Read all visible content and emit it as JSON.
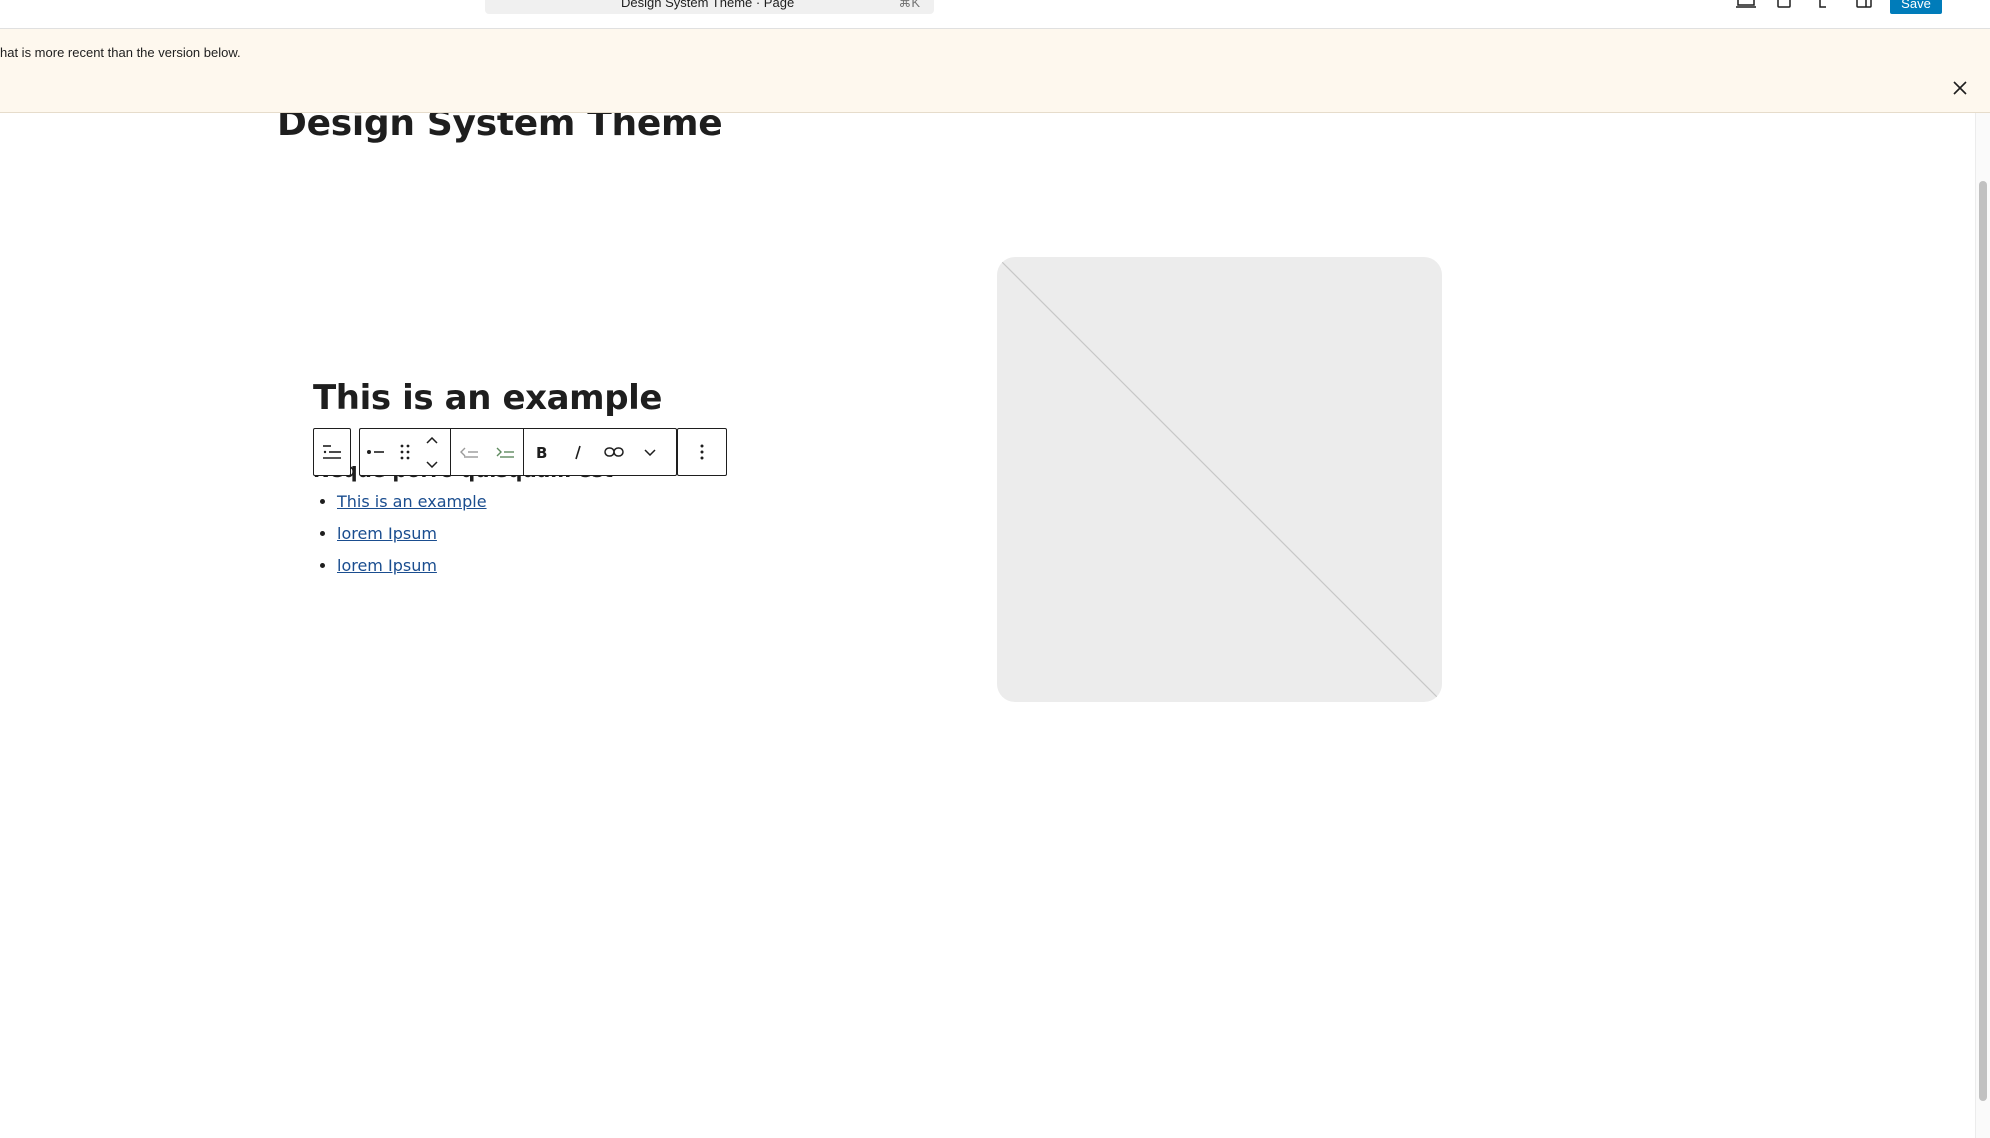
{
  "topbar": {
    "document_title": "Design System Theme · Page",
    "shortcut": "⌘K",
    "save_label": "Save",
    "icons": [
      "preview-icon",
      "view-icon",
      "document-icon",
      "settings-icon"
    ]
  },
  "notice": {
    "text": "hat is more recent than the version below."
  },
  "canvas": {
    "page_title": "Design System Theme",
    "heading": "This is an example",
    "subheading": "Neque porro quisquam est",
    "list_items": [
      {
        "label": "This is an example"
      },
      {
        "label": "lorem Ipsum"
      },
      {
        "label": "lorem Ipsum"
      }
    ]
  },
  "block_toolbar": {
    "buttons": [
      "list-icon",
      "bullet-list-icon",
      "drag-handle-icon",
      "move-up-icon",
      "move-down-icon",
      "outdent-icon",
      "indent-icon",
      "bold-icon",
      "italic-icon",
      "link-icon",
      "more-formats-icon",
      "options-icon"
    ]
  },
  "colors": {
    "accent": "#007cba",
    "notice_bg": "#fef8ee",
    "link": "#1a4d8f",
    "placeholder_bg": "#ececec"
  }
}
